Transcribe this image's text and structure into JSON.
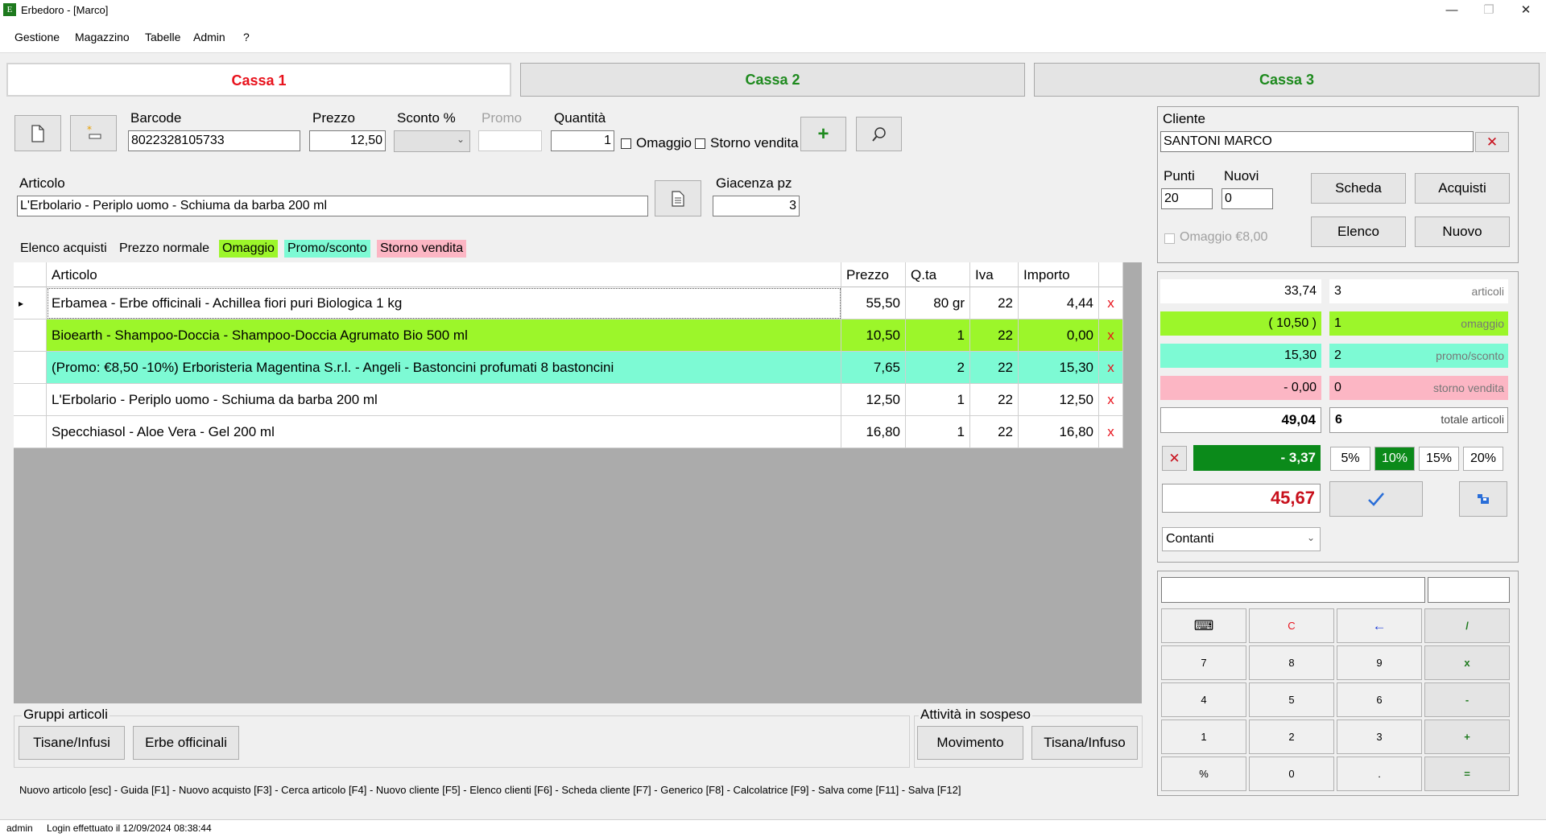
{
  "window": {
    "title": "Erbedoro - [Marco]",
    "icon_letter": "E"
  },
  "menu": [
    "Gestione",
    "Magazzino",
    "Tabelle",
    "Admin",
    "?"
  ],
  "tabs": [
    {
      "label": "Cassa 1",
      "active": true
    },
    {
      "label": "Cassa 2",
      "active": false
    },
    {
      "label": "Cassa 3",
      "active": false
    }
  ],
  "entry": {
    "barcode_label": "Barcode",
    "barcode_value": "8022328105733",
    "prezzo_label": "Prezzo",
    "prezzo_value": "12,50",
    "sconto_label": "Sconto %",
    "sconto_value": "",
    "promo_label": "Promo",
    "promo_value": "",
    "quantita_label": "Quantità",
    "quantita_value": "1",
    "omaggio_label": "Omaggio",
    "storno_label": "Storno vendita",
    "articolo_label": "Articolo",
    "articolo_value": "L'Erbolario - Periplo uomo - Schiuma da barba 200 ml",
    "giacenza_label": "Giacenza pz",
    "giacenza_value": "3"
  },
  "legend": {
    "elenco": "Elenco acquisti",
    "normale": "Prezzo normale",
    "omaggio": "Omaggio",
    "promo": "Promo/sconto",
    "storno": "Storno vendita"
  },
  "colors": {
    "omaggio": "#9cf62a",
    "promo": "#7dfad4",
    "storno": "#fcb6c4",
    "discount": "#0b8a1a",
    "total": "#c8101c",
    "tab_active": "#e8121c",
    "tab_inactive": "#1e8a1e"
  },
  "grid": {
    "headers": [
      "Articolo",
      "Prezzo",
      "Q.ta",
      "Iva",
      "Importo"
    ],
    "rows": [
      {
        "articolo": "Erbamea - Erbe officinali - Achillea fiori puri Biologica 1 kg",
        "prezzo": "55,50",
        "qta": "80 gr",
        "iva": "22",
        "importo": "4,44",
        "type": "normal",
        "current": true,
        "del": "x"
      },
      {
        "articolo": "Bioearth - Shampoo-Doccia - Shampoo-Doccia Agrumato Bio 500 ml",
        "prezzo": "10,50",
        "qta": "1",
        "iva": "22",
        "importo": "0,00",
        "type": "omaggio",
        "current": false,
        "del": "x"
      },
      {
        "articolo": "(Promo: €8,50 -10%) Erboristeria Magentina S.r.l. - Angeli - Bastoncini profumati 8 bastoncini",
        "prezzo": "7,65",
        "qta": "2",
        "iva": "22",
        "importo": "15,30",
        "type": "promo",
        "current": false,
        "del": "x"
      },
      {
        "articolo": "L'Erbolario - Periplo uomo - Schiuma da barba 200 ml",
        "prezzo": "12,50",
        "qta": "1",
        "iva": "22",
        "importo": "12,50",
        "type": "normal",
        "current": false,
        "del": "x"
      },
      {
        "articolo": "Specchiasol - Aloe Vera - Gel 200 ml",
        "prezzo": "16,80",
        "qta": "1",
        "iva": "22",
        "importo": "16,80",
        "type": "normal",
        "current": false,
        "del": "x"
      }
    ]
  },
  "gruppi": {
    "label": "Gruppi articoli",
    "buttons": [
      "Tisane/Infusi",
      "Erbe officinali"
    ]
  },
  "sospeso": {
    "label": "Attività in sospeso",
    "buttons": [
      "Movimento",
      "Tisana/Infuso"
    ]
  },
  "shortcuts": "Nuovo articolo [esc] - Guida [F1] - Nuovo acquisto [F3] - Cerca articolo [F4] - Nuovo cliente [F5] - Elenco clienti [F6] - Scheda cliente [F7] - Generico [F8] - Calcolatrice [F9] - Salva come [F11] - Salva [F12]",
  "cliente": {
    "label": "Cliente",
    "name": "SANTONI MARCO",
    "punti_label": "Punti",
    "punti_value": "20",
    "nuovi_label": "Nuovi",
    "nuovi_value": "0",
    "omaggio_label": "Omaggio €8,00",
    "buttons": {
      "scheda": "Scheda",
      "acquisti": "Acquisti",
      "elenco": "Elenco",
      "nuovo": "Nuovo"
    }
  },
  "summary": {
    "rows": [
      {
        "amount": "33,74",
        "count": "3",
        "label": "articoli",
        "type": "normal"
      },
      {
        "amount": "( 10,50 )",
        "count": "1",
        "label": "omaggio",
        "type": "omaggio"
      },
      {
        "amount": "15,30",
        "count": "2",
        "label": "promo/sconto",
        "type": "promo"
      },
      {
        "amount": "- 0,00",
        "count": "0",
        "label": "storno vendita",
        "type": "storno"
      }
    ],
    "totale_amount": "49,04",
    "totale_count": "6",
    "totale_label": "totale articoli",
    "discount": "- 3,37",
    "percents": [
      "5%",
      "10%",
      "15%",
      "20%"
    ],
    "percent_selected": "10%",
    "total": "45,67",
    "payment": "Contanti"
  },
  "calculator": {
    "keys": [
      [
        "⌨",
        "C",
        "←",
        "/"
      ],
      [
        "7",
        "8",
        "9",
        "x"
      ],
      [
        "4",
        "5",
        "6",
        "-"
      ],
      [
        "1",
        "2",
        "3",
        "+"
      ],
      [
        "%",
        "0",
        ".",
        "="
      ]
    ]
  },
  "status": {
    "user": "admin",
    "message": "Login effettuato il 12/09/2024 08:38:44"
  }
}
